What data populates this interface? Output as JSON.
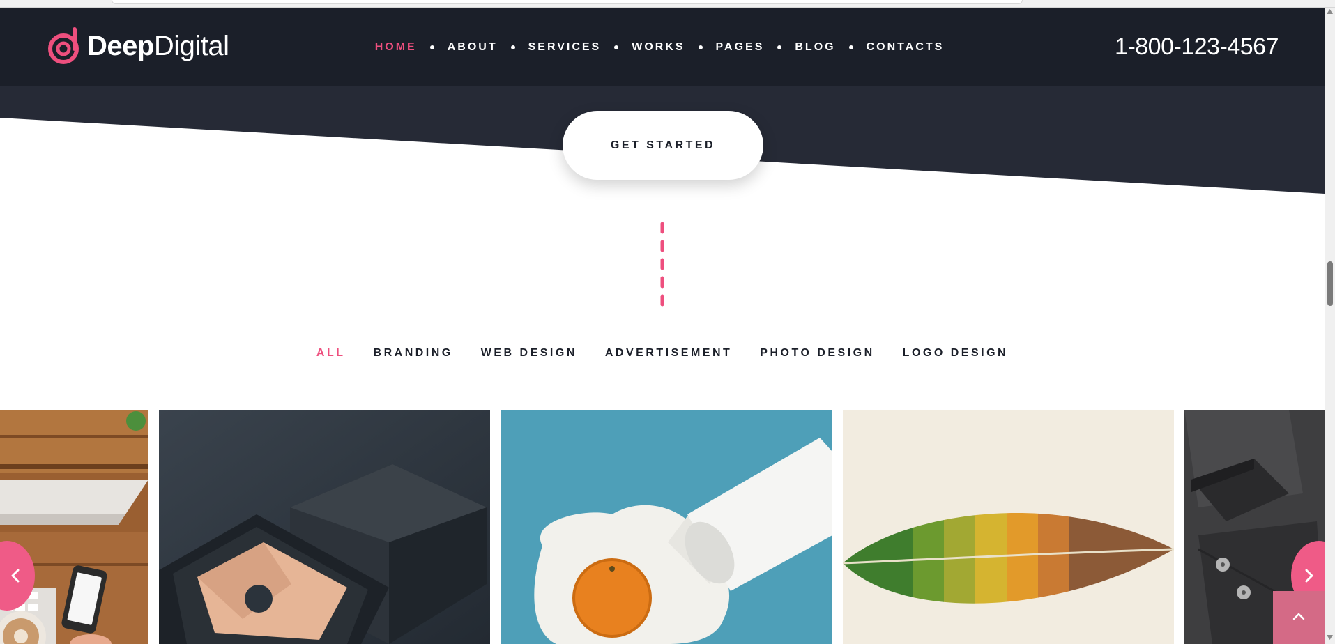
{
  "brand": {
    "name_bold": "Deep",
    "name_light": "Digital",
    "accent": "#ee4f7e",
    "dark": "#1b1f29"
  },
  "nav": {
    "items": [
      {
        "label": "HOME",
        "active": true
      },
      {
        "label": "ABOUT",
        "active": false
      },
      {
        "label": "SERVICES",
        "active": false
      },
      {
        "label": "WORKS",
        "active": false
      },
      {
        "label": "PAGES",
        "active": false
      },
      {
        "label": "BLOG",
        "active": false
      },
      {
        "label": "CONTACTS",
        "active": false
      }
    ]
  },
  "phone": "1-800-123-4567",
  "hero": {
    "cta_label": "GET STARTED"
  },
  "portfolio": {
    "filters": [
      {
        "label": "ALL",
        "active": true
      },
      {
        "label": "BRANDING",
        "active": false
      },
      {
        "label": "WEB DESIGN",
        "active": false
      },
      {
        "label": "ADVERTISEMENT",
        "active": false
      },
      {
        "label": "PHOTO DESIGN",
        "active": false
      },
      {
        "label": "LOGO DESIGN",
        "active": false
      }
    ],
    "items": [
      {
        "subject": "desk with phone and coffee"
      },
      {
        "subject": "black gift box with envelope"
      },
      {
        "subject": "spilled milk cup with orange"
      },
      {
        "subject": "color gradient leaf"
      },
      {
        "subject": "dark stationery mockup"
      }
    ]
  },
  "icons": {
    "logo": "logo-d-icon",
    "prev": "chevron-left-icon",
    "next": "chevron-right-icon",
    "back_to_top": "chevron-up-icon"
  }
}
